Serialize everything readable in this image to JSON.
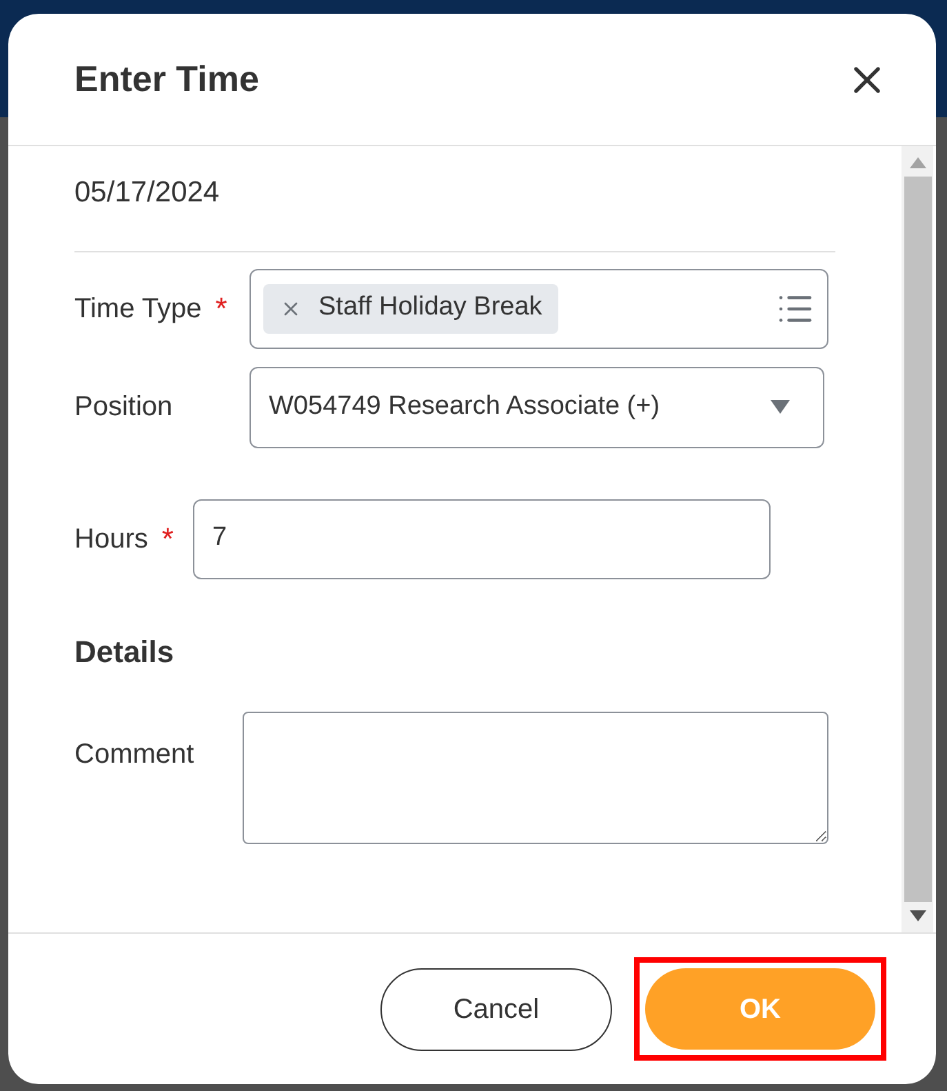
{
  "dialog": {
    "title": "Enter Time",
    "date": "05/17/2024",
    "fields": [
      {
        "kind": "multiselect",
        "label": "Time Type",
        "required_mark": "*",
        "tokens": [
          "Staff Holiday Break"
        ]
      },
      {
        "kind": "dropdown",
        "label": "Position",
        "value": "W054749 Research Associate (+)"
      },
      {
        "kind": "text",
        "label": "Hours",
        "required_mark": "*",
        "value": "7"
      }
    ],
    "section": "Details",
    "comment": {
      "label": "Comment"
    },
    "buttons": [
      {
        "label": "Cancel",
        "kind": "secondary",
        "highlighted": false
      },
      {
        "label": "OK",
        "kind": "primary",
        "highlighted": true
      }
    ]
  }
}
